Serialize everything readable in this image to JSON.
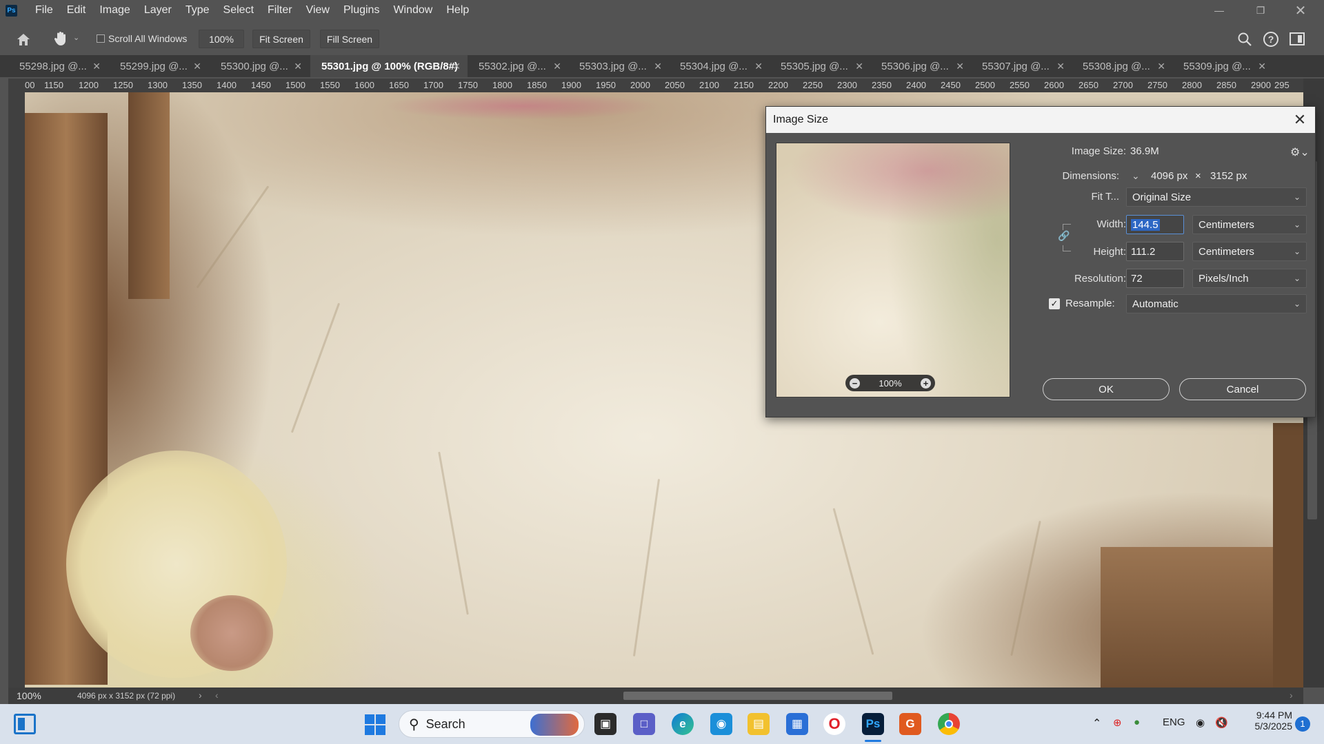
{
  "app": {
    "logo_text": "Ps",
    "menus": [
      "File",
      "Edit",
      "Image",
      "Layer",
      "Type",
      "Select",
      "Filter",
      "View",
      "Plugins",
      "Window",
      "Help"
    ],
    "window_controls": [
      "minimize",
      "restore",
      "close"
    ]
  },
  "options_bar": {
    "scroll_all_windows_label": "Scroll All Windows",
    "zoom_100_label": "100%",
    "fit_screen_label": "Fit Screen",
    "fill_screen_label": "Fill Screen"
  },
  "tabs": [
    {
      "label": "55298.jpg @...",
      "active": false
    },
    {
      "label": "55299.jpg @...",
      "active": false
    },
    {
      "label": "55300.jpg @...",
      "active": false
    },
    {
      "label": "55301.jpg @ 100% (RGB/8#)",
      "active": true
    },
    {
      "label": "55302.jpg @...",
      "active": false
    },
    {
      "label": "55303.jpg @...",
      "active": false
    },
    {
      "label": "55304.jpg @...",
      "active": false
    },
    {
      "label": "55305.jpg @...",
      "active": false
    },
    {
      "label": "55306.jpg @...",
      "active": false
    },
    {
      "label": "55307.jpg @...",
      "active": false
    },
    {
      "label": "55308.jpg @...",
      "active": false
    },
    {
      "label": "55309.jpg @...",
      "active": false
    }
  ],
  "ruler_ticks": [
    "00",
    "1150",
    "1200",
    "1250",
    "1300",
    "1350",
    "1400",
    "1450",
    "1500",
    "1550",
    "1600",
    "1650",
    "1700",
    "1750",
    "1800",
    "1850",
    "1900",
    "1950",
    "2000",
    "2050",
    "2100",
    "2150",
    "2200",
    "2250",
    "2300",
    "2350",
    "2400",
    "2450",
    "2500",
    "2550",
    "2600",
    "2650",
    "2700",
    "2750",
    "2800",
    "2850",
    "2900",
    "295"
  ],
  "status": {
    "zoom": "100%",
    "doc_info": "4096 px x 3152 px (72 ppi)"
  },
  "dialog": {
    "title": "Image Size",
    "preview_zoom": "100%",
    "image_size_label": "Image Size:",
    "image_size_value": "36.9M",
    "dimensions_label": "Dimensions:",
    "dimensions_width": "4096 px",
    "dimensions_x": "×",
    "dimensions_height": "3152 px",
    "fit_to_label": "Fit T...",
    "fit_to_value": "Original Size",
    "width_label": "Width:",
    "width_value": "144.5",
    "width_unit": "Centimeters",
    "height_label": "Height:",
    "height_value": "111.2",
    "height_unit": "Centimeters",
    "resolution_label": "Resolution:",
    "resolution_value": "72",
    "resolution_unit": "Pixels/Inch",
    "resample_label": "Resample:",
    "resample_checked": true,
    "resample_value": "Automatic",
    "ok_label": "OK",
    "cancel_label": "Cancel"
  },
  "taskbar": {
    "search_label": "Search",
    "language": "ENG",
    "time": "9:44 PM",
    "date": "5/3/2025",
    "notification_count": "1"
  }
}
